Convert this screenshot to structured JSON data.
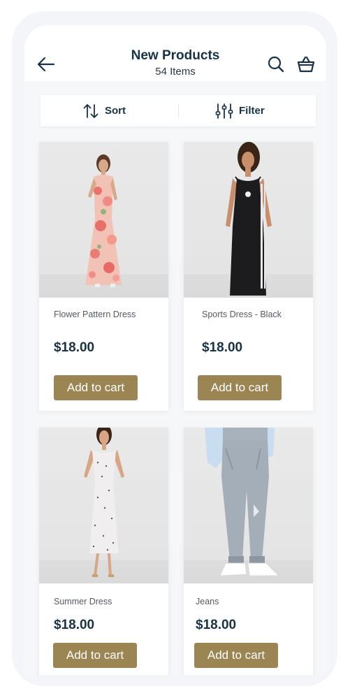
{
  "header": {
    "title": "New Products",
    "subtitle": "54 Items",
    "icons": [
      "arrow-left-icon",
      "search-icon",
      "basket-icon"
    ]
  },
  "toolbar": {
    "sort_label": "Sort",
    "filter_label": "Filter"
  },
  "products": [
    {
      "name": "Flower Pattern Dress",
      "price": "$18.00",
      "button": "Add to cart"
    },
    {
      "name": "Sports Dress - Black",
      "price": "$18.00",
      "button": "Add to cart"
    },
    {
      "name": "Summer Dress",
      "price": "$18.00",
      "button": "Add to cart"
    },
    {
      "name": "Jeans",
      "price": "$18.00",
      "button": "Add to cart"
    }
  ],
  "colors": {
    "accent": "#9b8553",
    "text_dark": "#173246",
    "background": "#f6f7f9"
  }
}
